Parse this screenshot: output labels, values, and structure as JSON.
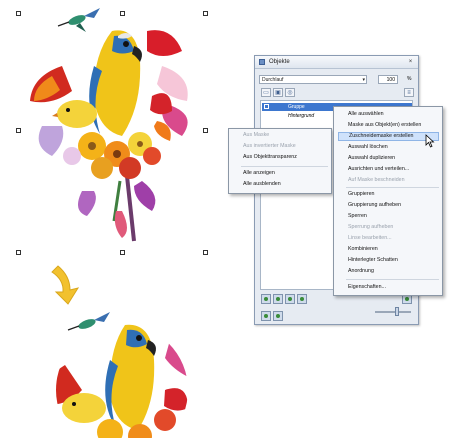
{
  "panel": {
    "title": "Objekte",
    "close_glyph": "×",
    "blend_mode": "Durchlauf",
    "opacity": "100",
    "opacity_unit": "%",
    "layers": [
      "Gruppe",
      "Hintergrund"
    ]
  },
  "left_menu": {
    "items": [
      "Aus Maske",
      "Aus invertierter Maske",
      "Aus Objekttransparenz",
      "Alle anzeigen",
      "Alle ausblenden"
    ]
  },
  "right_menu": {
    "items": [
      "Alle auswählen",
      "Maske aus Objekt(en) erstellen",
      "Zuschneidemaske erstellen",
      "Auswahl löschen",
      "Auswahl duplizieren",
      "Ausrichten und verteilen...",
      "Auf Maske beschneiden",
      "Gruppieren",
      "Gruppierung aufheben",
      "Sperren",
      "Sperrung aufheben",
      "Linse bearbeiten...",
      "Kombinieren",
      "Hinterlegter Schatten",
      "Anordnung",
      "Eigenschaften..."
    ],
    "highlighted": "Zuschneidemaske erstellen"
  },
  "colors": {
    "arrow": "#f2c12e",
    "selection": "#3d77cf",
    "menu_highlight": "#cfe2fb"
  },
  "icons": [
    "hummingbird-image",
    "parrot-bouquet-image",
    "down-arrow-icon",
    "cursor-arrow-icon"
  ]
}
